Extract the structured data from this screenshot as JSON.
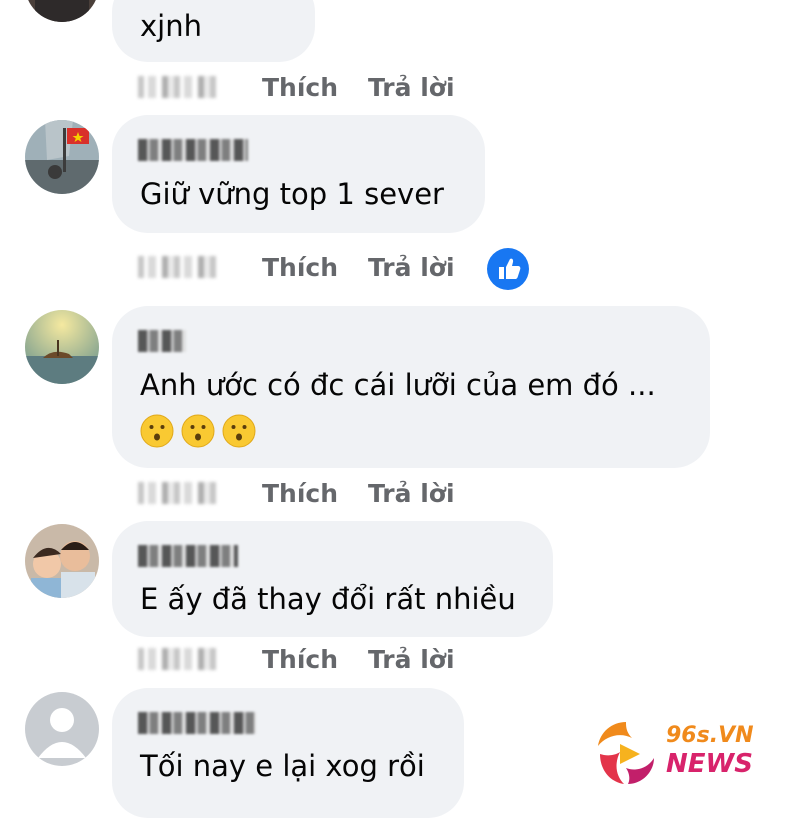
{
  "comments": [
    {
      "id": "c0",
      "author": "",
      "text": "xjnh",
      "timestamp": "",
      "like_label": "Thích",
      "reply_label": "Trả lời",
      "reaction": null
    },
    {
      "id": "c1",
      "author": "■■ ■■",
      "text": "Giữ vững top 1 sever",
      "timestamp": "",
      "like_label": "Thích",
      "reply_label": "Trả lời",
      "reaction": "like"
    },
    {
      "id": "c2",
      "author": "■■",
      "text": "Anh ước có đc cái lưỡi của em đó ...",
      "emoji_count": 3,
      "emoji": "🫢",
      "timestamp": "",
      "like_label": "Thích",
      "reply_label": "Trả lời",
      "reaction": null
    },
    {
      "id": "c3",
      "author": "■■ ■■",
      "text": "E ấy đã thay đổi rất nhiều",
      "timestamp": "",
      "like_label": "Thích",
      "reply_label": "Trả lời",
      "reaction": null
    },
    {
      "id": "c4",
      "author": "■■■ ■■",
      "text": "Tối nay e lại xog rồi",
      "timestamp": "",
      "like_label": "Thích",
      "reply_label": "Trả lời",
      "reaction": null
    }
  ],
  "watermark": {
    "line1": "96s.VN",
    "line2": "NEWS"
  },
  "colors": {
    "bubble": "#f0f2f5",
    "action_text": "#65676b",
    "like_blue": "#1877f2",
    "logo_orange": "#f08a1c",
    "logo_pink": "#d8236b"
  }
}
